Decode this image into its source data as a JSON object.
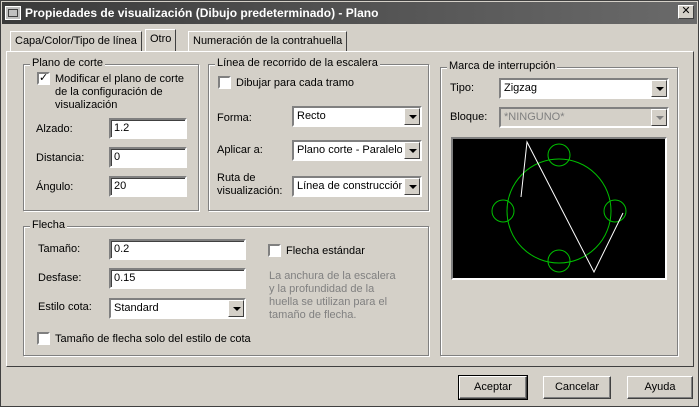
{
  "window": {
    "title": "Propiedades de visualización (Dibujo predeterminado) - Plano",
    "close_glyph": "✕"
  },
  "tabs": [
    "Capa/Color/Tipo de línea",
    "Otro",
    "Numeración de la contrahuella"
  ],
  "active_tab": "Otro",
  "cut_plane": {
    "legend": "Plano de corte",
    "modify_checkbox_checked": true,
    "modify_label_line1": "Modificar el plano de corte",
    "modify_label_line2": "de la configuración de",
    "modify_label_line3": "visualización",
    "elevation_label": "Alzado:",
    "elevation_value": "1.2",
    "distance_label": "Distancia:",
    "distance_value": "0",
    "angle_label": "Ángulo:",
    "angle_value": "20"
  },
  "run_line": {
    "legend": "Línea de recorrido de la escalera",
    "draw_each_checkbox_checked": false,
    "draw_each_label": "Dibujar para cada tramo",
    "shape_label": "Forma:",
    "shape_value": "Recto",
    "apply_label": "Aplicar a:",
    "apply_value": "Plano corte - Paralelo",
    "path_label_line1": "Ruta de",
    "path_label_line2": "visualización:",
    "path_value": "Línea de construcción"
  },
  "break_mark": {
    "legend": "Marca de interrupción",
    "type_label": "Tipo:",
    "type_value": "Zigzag",
    "block_label": "Bloque:",
    "block_value": "*NINGUNO*"
  },
  "arrow": {
    "legend": "Flecha",
    "size_label": "Tamaño:",
    "size_value": "0.2",
    "offset_label": "Desfase:",
    "offset_value": "0.15",
    "dimstyle_label": "Estilo cota:",
    "dimstyle_value": "Standard",
    "standard_checkbox_checked": false,
    "standard_label": "Flecha estándar",
    "note_line1": "La anchura de la escalera",
    "note_line2": "y la profundidad de la",
    "note_line3": "huella se utilizan para el",
    "note_line4": "tamaño de flecha.",
    "dimstyle_only_checked": false,
    "dimstyle_only_label": "Tamaño de flecha solo del estilo de cota"
  },
  "buttons": {
    "accept": "Aceptar",
    "cancel": "Cancelar",
    "help": "Ayuda"
  },
  "colors": {
    "preview_bg": "#000000",
    "circle_color": "#00c000",
    "zigzag_color": "#ffffff"
  }
}
